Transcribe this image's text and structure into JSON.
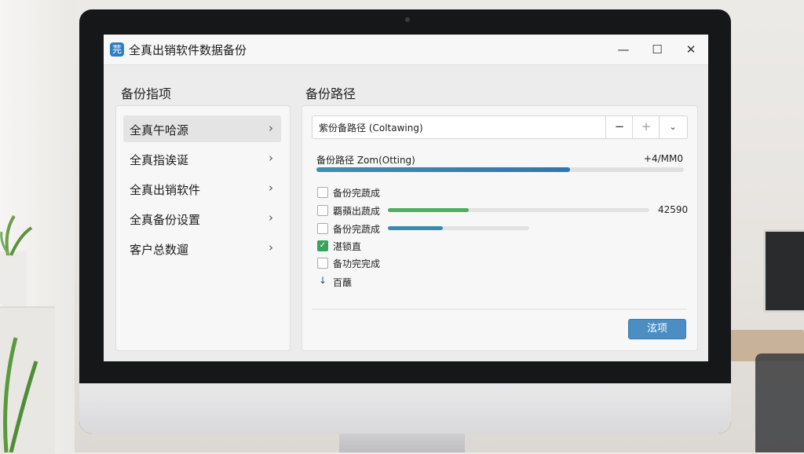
{
  "window": {
    "title": "全真出销软件数据备份",
    "app_icon_glyph": "芫",
    "minimize_glyph": "—",
    "maximize_glyph": "☐",
    "close_glyph": "✕"
  },
  "sidebar": {
    "header": "备份指项",
    "items": [
      {
        "label": "全真午哈源",
        "active": true
      },
      {
        "label": "全真指诶诞",
        "active": false
      },
      {
        "label": "全真出销软件",
        "active": false
      },
      {
        "label": "全真备份设置",
        "active": false
      },
      {
        "label": "客户总数遛",
        "active": false
      }
    ],
    "chevron_glyph": "›"
  },
  "main": {
    "header": "备份路径",
    "path_field": {
      "value": "紫份备路径 (Coltawing)",
      "minus_glyph": "−",
      "plus_glyph": "+",
      "dropdown_glyph": "⌄"
    },
    "progress": {
      "label": "备份路径 Zom(Otting)",
      "value_text": "+4/MM0",
      "fraction": 0.69
    },
    "tasks": [
      {
        "label": "备份完蔬成",
        "checked": false
      },
      {
        "label": "覇蘋出蔬成",
        "checked": false,
        "progress": 0.31,
        "value_text": "42590"
      },
      {
        "label": "备份完蔬成",
        "checked": false,
        "progress": 0.39
      },
      {
        "label": "湛锁直",
        "checked": true
      },
      {
        "label": "备功完完成",
        "checked": false
      }
    ],
    "footer_item": {
      "label": "百蘸",
      "glyph": "↓"
    },
    "ok_button_label": "泫项"
  },
  "colors": {
    "accent": "#4a8ec4",
    "progress_blue": "#2f76b0",
    "green": "#4caf61",
    "teal": "#3a8aa8"
  }
}
